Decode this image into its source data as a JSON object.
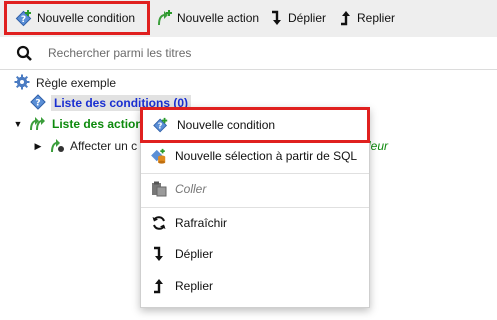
{
  "toolbar": {
    "new_condition": "Nouvelle condition",
    "new_action": "Nouvelle action",
    "expand": "Déplier",
    "collapse": "Replier"
  },
  "search": {
    "placeholder": "Rechercher parmi les titres"
  },
  "tree": {
    "rule": "Règle exemple",
    "conditions_list": "Liste des conditions (0)",
    "actions_list": "Liste des actions",
    "assign_item": "Affecter un c",
    "assign_value_tail": "leur"
  },
  "context_menu": {
    "items": [
      {
        "label": "Nouvelle condition"
      },
      {
        "label": "Nouvelle sélection à partir de SQL"
      },
      {
        "label": "Coller"
      },
      {
        "label": "Rafraîchir"
      },
      {
        "label": "Déplier"
      },
      {
        "label": "Replier"
      }
    ]
  },
  "colors": {
    "highlight": "#e0201f",
    "conditions_text": "#1a2fd1",
    "actions_text": "#0d8a0d",
    "condition_icon": "#5b8fd6",
    "action_icon": "#3b9e3b"
  }
}
